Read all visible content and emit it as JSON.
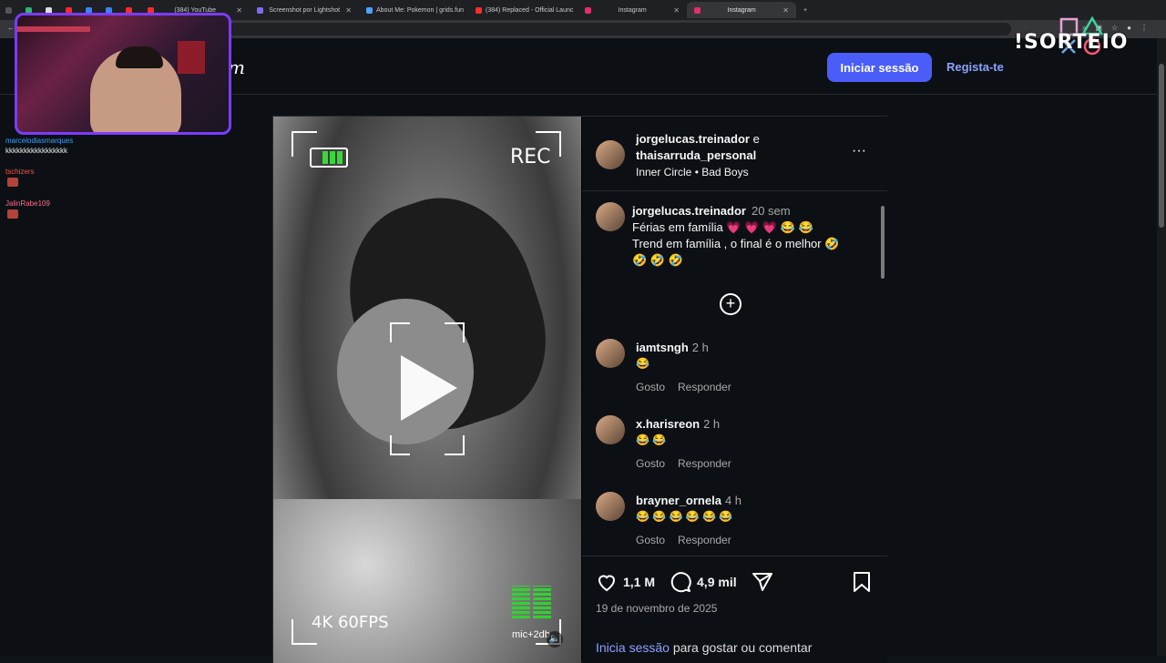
{
  "browser": {
    "tabs": [
      {
        "label": "(384) YouTube",
        "favicon_color": "#ff2b2b"
      },
      {
        "label": "Screenshot por Lightshot",
        "favicon_color": "#7b6cf6"
      },
      {
        "label": "About Me: Pokemon | grids.fun",
        "favicon_color": "#4aa3ff"
      },
      {
        "label": "(384) Replaced - Official Launc",
        "favicon_color": "#ff2b2b"
      },
      {
        "label": "Instagram",
        "favicon_color": "#e1306c"
      },
      {
        "label": "Instagram",
        "favicon_color": "#e1306c"
      }
    ],
    "new_tab": "+"
  },
  "overlay": {
    "sorteio": "!SORTEIO",
    "chat": [
      {
        "user": "marcelodiasmarques",
        "color": "#3aa0ff",
        "message": "kkkkkkkkkkkkkkkkk"
      },
      {
        "user": "tschizers",
        "color": "#ff4b4b",
        "message": ""
      },
      {
        "user": "JalinRabe109",
        "color": "#ff6b8b",
        "message": ""
      }
    ]
  },
  "header": {
    "logo_fragment": "m",
    "login_label": "Iniciar sessão",
    "signup_label": "Regista-te"
  },
  "media": {
    "rec_label": "REC",
    "quality_label": "4K  60FPS",
    "mic_label": "mic+2db"
  },
  "post": {
    "author_1": "jorgelucas.treinador",
    "and_word": "e",
    "author_2": "thaisarruda_personal",
    "audio": "Inner Circle • Bad Boys",
    "more_icon": "···",
    "caption": {
      "user": "jorgelucas.treinador",
      "time": "20 sem",
      "line1": "Férias em família 💗 💗 💗 😂 😂",
      "line2": "Trend em família , o final é o melhor 🤣",
      "line3": "🤣 🤣 🤣"
    },
    "load_more": "+",
    "comments": [
      {
        "user": "iamtsngh",
        "time": "2 h",
        "text": "😂",
        "like": "Gosto",
        "reply": "Responder"
      },
      {
        "user": "x.harisreon",
        "time": "2 h",
        "text": "😂 😂",
        "like": "Gosto",
        "reply": "Responder"
      },
      {
        "user": "brayner_ornela",
        "time": "4 h",
        "text": "😂 😂 😂 😂 😂 😂",
        "like": "Gosto",
        "reply": "Responder"
      }
    ],
    "likes": "1,1 M",
    "comments_count": "4,9 mil",
    "date": "19 de novembro de 2025",
    "login_prompt_link": "Inicia sessão",
    "login_prompt_rest": " para gostar ou comentar"
  },
  "colors": {
    "accent": "#4a5df9",
    "link": "#8ea1ff",
    "background": "#0c1014"
  }
}
